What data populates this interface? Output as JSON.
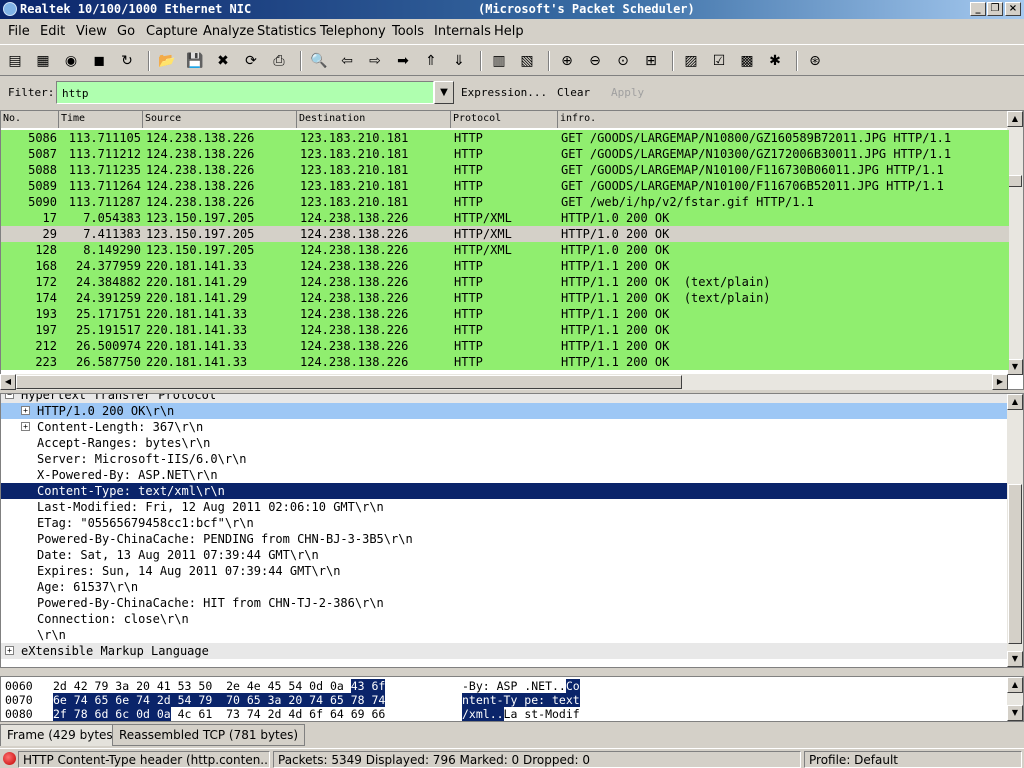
{
  "window": {
    "title_left": "Realtek 10/100/1000 Ethernet NIC",
    "title_center": "(Microsoft's Packet Scheduler)"
  },
  "menu": [
    "File",
    "Edit",
    "View",
    "Go",
    "Capture",
    "Analyze",
    "Statistics",
    "Telephony",
    "Tools",
    "Internals",
    "Help"
  ],
  "toolbar_icons": [
    "interfaces-icon",
    "options-icon",
    "start-icon",
    "stop-icon",
    "restart-icon",
    "open-icon",
    "save-icon",
    "close-icon",
    "reload-icon",
    "print-icon",
    "find-icon",
    "back-icon",
    "forward-icon",
    "goto-icon",
    "first-icon",
    "last-icon",
    "colorize-icon",
    "autoscroll-icon",
    "zoom-in-icon",
    "zoom-out-icon",
    "normal-size-icon",
    "resize-columns-icon",
    "capture-filters-icon",
    "display-filters-icon",
    "coloring-rules-icon",
    "preferences-icon",
    "help-icon"
  ],
  "filter": {
    "label": "Filter:",
    "value": "http",
    "expression": "Expression...",
    "clear": "Clear",
    "apply": "Apply"
  },
  "columns": [
    "No.",
    "Time",
    "Source",
    "Destination",
    "Protocol",
    "infro."
  ],
  "packets": [
    {
      "no": "5086",
      "time": "113.711105",
      "src": "124.238.138.226",
      "dst": "123.183.210.181",
      "proto": "HTTP",
      "info": "GET /GOODS/LARGEMAP/N10800/GZ160589B72011.JPG HTTP/1.1",
      "color": "#90ee6f"
    },
    {
      "no": "5087",
      "time": "113.711212",
      "src": "124.238.138.226",
      "dst": "123.183.210.181",
      "proto": "HTTP",
      "info": "GET /GOODS/LARGEMAP/N10300/GZ172006B30011.JPG HTTP/1.1",
      "color": "#90ee6f"
    },
    {
      "no": "5088",
      "time": "113.711235",
      "src": "124.238.138.226",
      "dst": "123.183.210.181",
      "proto": "HTTP",
      "info": "GET /GOODS/LARGEMAP/N10100/F116730B06011.JPG HTTP/1.1",
      "color": "#90ee6f"
    },
    {
      "no": "5089",
      "time": "113.711264",
      "src": "124.238.138.226",
      "dst": "123.183.210.181",
      "proto": "HTTP",
      "info": "GET /GOODS/LARGEMAP/N10100/F116706B52011.JPG HTTP/1.1",
      "color": "#90ee6f"
    },
    {
      "no": "5090",
      "time": "113.711287",
      "src": "124.238.138.226",
      "dst": "123.183.210.181",
      "proto": "HTTP",
      "info": "GET /web/i/hp/v2/fstar.gif HTTP/1.1",
      "color": "#90ee6f"
    },
    {
      "no": "17",
      "time": "7.054383",
      "src": "123.150.197.205",
      "dst": "124.238.138.226",
      "proto": "HTTP/XML",
      "info": "HTTP/1.0 200 OK",
      "color": "#90ee6f"
    },
    {
      "no": "29",
      "time": "7.411383",
      "src": "123.150.197.205",
      "dst": "124.238.138.226",
      "proto": "HTTP/XML",
      "info": "HTTP/1.0 200 OK",
      "color": "#d4d0c8"
    },
    {
      "no": "128",
      "time": "8.149290",
      "src": "123.150.197.205",
      "dst": "124.238.138.226",
      "proto": "HTTP/XML",
      "info": "HTTP/1.0 200 OK",
      "color": "#90ee6f"
    },
    {
      "no": "168",
      "time": "24.377959",
      "src": "220.181.141.33",
      "dst": "124.238.138.226",
      "proto": "HTTP",
      "info": "HTTP/1.1 200 OK",
      "color": "#90ee6f"
    },
    {
      "no": "172",
      "time": "24.384882",
      "src": "220.181.141.29",
      "dst": "124.238.138.226",
      "proto": "HTTP",
      "info": "HTTP/1.1 200 OK  (text/plain)",
      "color": "#90ee6f"
    },
    {
      "no": "174",
      "time": "24.391259",
      "src": "220.181.141.29",
      "dst": "124.238.138.226",
      "proto": "HTTP",
      "info": "HTTP/1.1 200 OK  (text/plain)",
      "color": "#90ee6f"
    },
    {
      "no": "193",
      "time": "25.171751",
      "src": "220.181.141.33",
      "dst": "124.238.138.226",
      "proto": "HTTP",
      "info": "HTTP/1.1 200 OK",
      "color": "#90ee6f"
    },
    {
      "no": "197",
      "time": "25.191517",
      "src": "220.181.141.33",
      "dst": "124.238.138.226",
      "proto": "HTTP",
      "info": "HTTP/1.1 200 OK",
      "color": "#90ee6f"
    },
    {
      "no": "212",
      "time": "26.500974",
      "src": "220.181.141.33",
      "dst": "124.238.138.226",
      "proto": "HTTP",
      "info": "HTTP/1.1 200 OK",
      "color": "#90ee6f"
    },
    {
      "no": "223",
      "time": "26.587750",
      "src": "220.181.141.33",
      "dst": "124.238.138.226",
      "proto": "HTTP",
      "info": "HTTP/1.1 200 OK",
      "color": "#90ee6f"
    }
  ],
  "details": [
    {
      "text": "Hypertext Transfer Protocol",
      "level": 0,
      "expander": "−",
      "style": "gray"
    },
    {
      "text": "HTTP/1.0 200 OK\\r\\n",
      "level": 1,
      "expander": "+",
      "style": "light"
    },
    {
      "text": "Content-Length: 367\\r\\n",
      "level": 1,
      "expander": "+",
      "style": ""
    },
    {
      "text": "Accept-Ranges: bytes\\r\\n",
      "level": 1,
      "expander": "",
      "style": ""
    },
    {
      "text": "Server: Microsoft-IIS/6.0\\r\\n",
      "level": 1,
      "expander": "",
      "style": ""
    },
    {
      "text": "X-Powered-By: ASP.NET\\r\\n",
      "level": 1,
      "expander": "",
      "style": ""
    },
    {
      "text": "Content-Type: text/xml\\r\\n",
      "level": 1,
      "expander": "",
      "style": "selected"
    },
    {
      "text": "Last-Modified: Fri, 12 Aug 2011 02:06:10 GMT\\r\\n",
      "level": 1,
      "expander": "",
      "style": ""
    },
    {
      "text": "ETag: \"05565679458cc1:bcf\"\\r\\n",
      "level": 1,
      "expander": "",
      "style": ""
    },
    {
      "text": "Powered-By-ChinaCache: PENDING from CHN-BJ-3-3B5\\r\\n",
      "level": 1,
      "expander": "",
      "style": ""
    },
    {
      "text": "Date: Sat, 13 Aug 2011 07:39:44 GMT\\r\\n",
      "level": 1,
      "expander": "",
      "style": ""
    },
    {
      "text": "Expires: Sun, 14 Aug 2011 07:39:44 GMT\\r\\n",
      "level": 1,
      "expander": "",
      "style": ""
    },
    {
      "text": "Age: 61537\\r\\n",
      "level": 1,
      "expander": "",
      "style": ""
    },
    {
      "text": "Powered-By-ChinaCache: HIT from CHN-TJ-2-386\\r\\n",
      "level": 1,
      "expander": "",
      "style": ""
    },
    {
      "text": "Connection: close\\r\\n",
      "level": 1,
      "expander": "",
      "style": ""
    },
    {
      "text": "\\r\\n",
      "level": 1,
      "expander": "",
      "style": ""
    },
    {
      "text": "eXtensible Markup Language",
      "level": 0,
      "expander": "+",
      "style": "gray"
    }
  ],
  "bytes": [
    {
      "offset": "0060",
      "hex_plain": "2d 42 79 3a 20 41 53 50  2e 4e 45 54 0d 0a ",
      "hex_hl": "43 6f",
      "ascii_plain": "-By: ASP .NET..",
      "ascii_hl": "Co"
    },
    {
      "offset": "0070",
      "hex_plain": "",
      "hex_hl": "6e 74 65 6e 74 2d 54 79  70 65 3a 20 74 65 78 74",
      "ascii_plain": "",
      "ascii_hl": "ntent-Ty pe: text"
    },
    {
      "offset": "0080",
      "hex_plain": "",
      "hex_hl": "2f 78 6d 6c 0d 0a",
      "hex_rest": " 4c 61  73 74 2d 4d 6f 64 69 66",
      "ascii_plain": "",
      "ascii_hl": "/xml..",
      "ascii_rest": "La st-Modif"
    }
  ],
  "byte_tabs": [
    "Frame (429 bytes)",
    "Reassembled TCP (781 bytes)"
  ],
  "status": {
    "field": "HTTP Content-Type header (http.conten...",
    "packets": "Packets: 5349 Displayed: 796 Marked: 0 Dropped: 0",
    "profile": "Profile: Default"
  }
}
